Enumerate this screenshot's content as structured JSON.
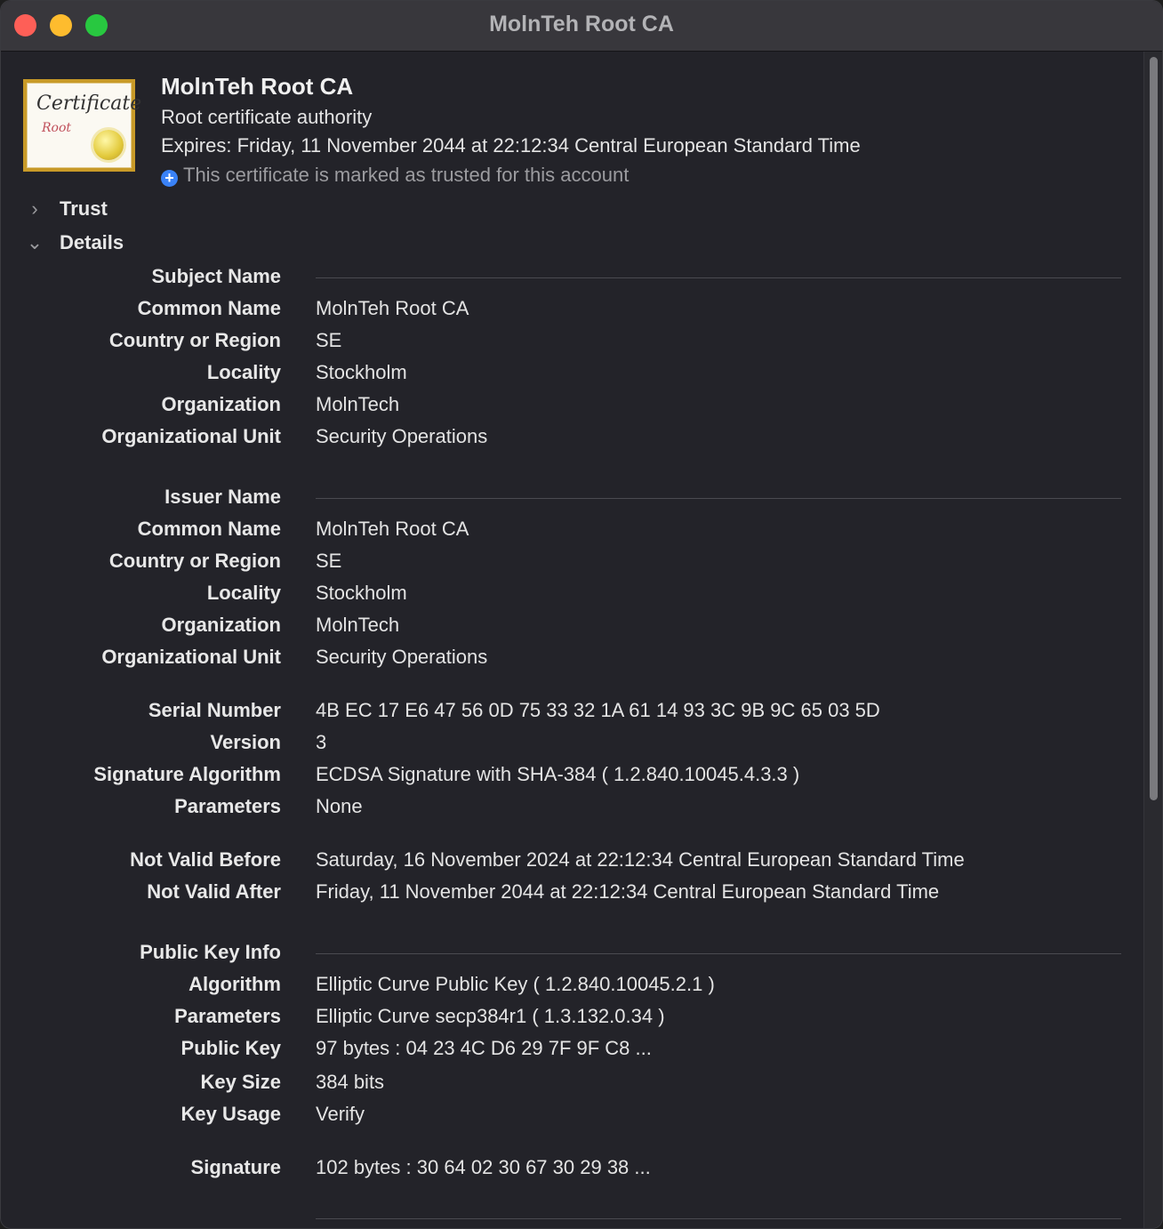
{
  "window": {
    "title": "MolnTeh Root CA"
  },
  "header": {
    "name": "MolnTeh Root CA",
    "kind": "Root certificate authority",
    "expires": "Expires: Friday, 11 November 2044 at 22:12:34 Central European Standard Time",
    "trusted": "This certificate is marked as trusted for this account",
    "icon_text": "Certificate",
    "icon_subtext": "Root"
  },
  "sections": {
    "trust": "Trust",
    "details": "Details"
  },
  "subject": {
    "heading": "Subject Name",
    "rows": [
      {
        "label": "Common Name",
        "value": "MolnTeh Root CA"
      },
      {
        "label": "Country or Region",
        "value": "SE"
      },
      {
        "label": "Locality",
        "value": "Stockholm"
      },
      {
        "label": "Organization",
        "value": "MolnTech"
      },
      {
        "label": "Organizational Unit",
        "value": "Security Operations"
      }
    ]
  },
  "issuer": {
    "heading": "Issuer Name",
    "rows": [
      {
        "label": "Common Name",
        "value": "MolnTeh Root CA"
      },
      {
        "label": "Country or Region",
        "value": "SE"
      },
      {
        "label": "Locality",
        "value": "Stockholm"
      },
      {
        "label": "Organization",
        "value": "MolnTech"
      },
      {
        "label": "Organizational Unit",
        "value": "Security Operations"
      }
    ]
  },
  "general": {
    "rows": [
      {
        "label": "Serial Number",
        "value": "4B EC 17 E6 47 56 0D 75 33 32 1A 61 14 93 3C 9B 9C 65 03 5D"
      },
      {
        "label": "Version",
        "value": "3"
      },
      {
        "label": "Signature Algorithm",
        "value": "ECDSA Signature with SHA-384 ( 1.2.840.10045.4.3.3 )"
      },
      {
        "label": "Parameters",
        "value": "None"
      }
    ]
  },
  "validity": {
    "rows": [
      {
        "label": "Not Valid Before",
        "value": "Saturday, 16 November 2024 at 22:12:34 Central European Standard Time"
      },
      {
        "label": "Not Valid After",
        "value": "Friday, 11 November 2044 at 22:12:34 Central European Standard Time"
      }
    ]
  },
  "public_key": {
    "heading": "Public Key Info",
    "rows": [
      {
        "label": "Algorithm",
        "value": "Elliptic Curve Public Key ( 1.2.840.10045.2.1 )"
      },
      {
        "label": "Parameters",
        "value": "Elliptic Curve secp384r1 ( 1.3.132.0.34 )"
      },
      {
        "label": "Public Key",
        "value": "97 bytes : 04 23 4C D6 29 7F 9F C8 ..."
      },
      {
        "label": "Key Size",
        "value": "384 bits"
      },
      {
        "label": "Key Usage",
        "value": "Verify"
      }
    ]
  },
  "signature": {
    "rows": [
      {
        "label": "Signature",
        "value": "102 bytes : 30 64 02 30 67 30 29 38 ..."
      }
    ]
  }
}
